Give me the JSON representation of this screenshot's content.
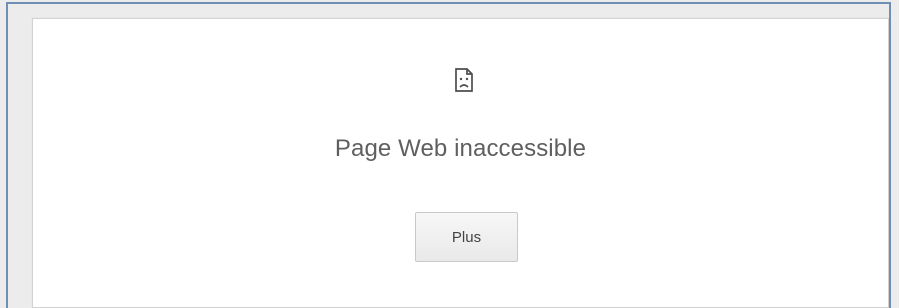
{
  "error_page": {
    "icon": "sad-page-icon",
    "title": "Page Web inaccessible",
    "more_button_label": "Plus"
  },
  "colors": {
    "frame_border": "#6f8fb4",
    "text": "#5f5f5f",
    "button_bg": "#efefef"
  }
}
